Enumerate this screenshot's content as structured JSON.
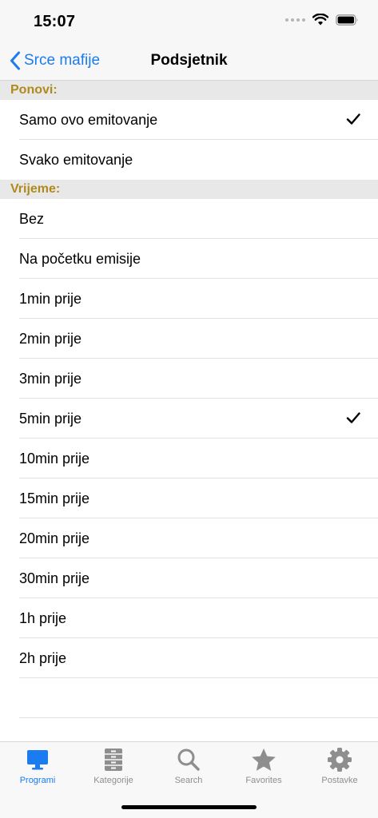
{
  "status_bar": {
    "time": "15:07"
  },
  "nav": {
    "back_label": "Srce mafije",
    "title": "Podsjetnik"
  },
  "sections": [
    {
      "header": "Ponovi:",
      "items": [
        {
          "label": "Samo ovo emitovanje",
          "checked": true
        },
        {
          "label": "Svako emitovanje",
          "checked": false
        }
      ]
    },
    {
      "header": "Vrijeme:",
      "items": [
        {
          "label": "Bez",
          "checked": false
        },
        {
          "label": "Na početku emisije",
          "checked": false
        },
        {
          "label": "1min prije",
          "checked": false
        },
        {
          "label": "2min prije",
          "checked": false
        },
        {
          "label": "3min prije",
          "checked": false
        },
        {
          "label": "5min prije",
          "checked": true
        },
        {
          "label": "10min prije",
          "checked": false
        },
        {
          "label": "15min prije",
          "checked": false
        },
        {
          "label": "20min prije",
          "checked": false
        },
        {
          "label": "30min prije",
          "checked": false
        },
        {
          "label": "1h prije",
          "checked": false
        },
        {
          "label": "2h prije",
          "checked": false
        }
      ]
    }
  ],
  "tabs": [
    {
      "label": "Programi",
      "icon": "monitor-icon",
      "active": true
    },
    {
      "label": "Kategorije",
      "icon": "cabinet-icon",
      "active": false
    },
    {
      "label": "Search",
      "icon": "search-icon",
      "active": false
    },
    {
      "label": "Favorites",
      "icon": "star-icon",
      "active": false
    },
    {
      "label": "Postavke",
      "icon": "gear-icon",
      "active": false
    }
  ],
  "colors": {
    "accent": "#1a7cf0",
    "section_header_text": "#b08a1e",
    "inactive_tab": "#8e8e8e"
  }
}
